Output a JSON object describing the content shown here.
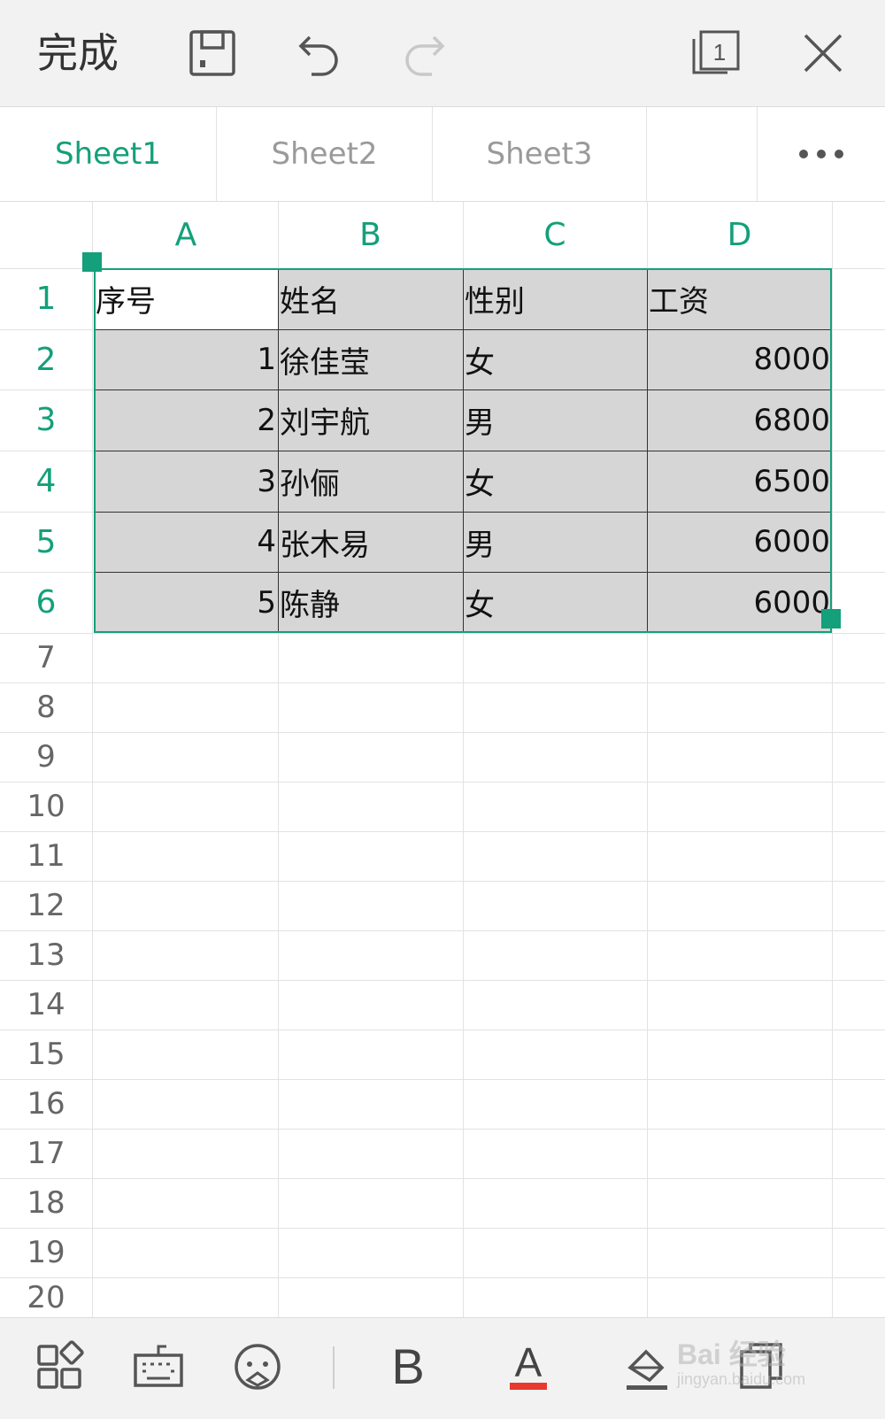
{
  "toolbar": {
    "done_label": "完成",
    "icons": [
      "save-icon",
      "undo-icon",
      "redo-icon",
      "window-count-icon",
      "close-icon"
    ],
    "window_count": "1"
  },
  "tabs": [
    {
      "label": "Sheet1",
      "active": true
    },
    {
      "label": "Sheet2",
      "active": false
    },
    {
      "label": "Sheet3",
      "active": false
    }
  ],
  "columns": [
    "A",
    "B",
    "C",
    "D"
  ],
  "rows": [
    "1",
    "2",
    "3",
    "4",
    "5",
    "6",
    "7",
    "8",
    "9",
    "10",
    "11",
    "12",
    "13",
    "14",
    "15",
    "16",
    "17",
    "18",
    "19",
    "20"
  ],
  "table": {
    "header": [
      "序号",
      "姓名",
      "性别",
      "工资"
    ],
    "data": [
      [
        "1",
        "徐佳莹",
        "女",
        "8000"
      ],
      [
        "2",
        "刘宇航",
        "男",
        "6800"
      ],
      [
        "3",
        "孙俪",
        "女",
        "6500"
      ],
      [
        "4",
        "张木易",
        "男",
        "6000"
      ],
      [
        "5",
        "陈静",
        "女",
        "6000"
      ]
    ]
  },
  "selection": {
    "range": "A1:D6",
    "color": "#13a07a"
  },
  "bottom_bar": {
    "icons": [
      "apps-icon",
      "keyboard-icon",
      "emoji-icon",
      "bold-icon",
      "font-color-icon",
      "fill-color-icon",
      "copy-icon"
    ],
    "bold_label": "B",
    "font_color_label": "A",
    "font_color": "#e8392f"
  },
  "colors": {
    "accent": "#13a07a",
    "selected_fill": "#d6d6d6"
  },
  "watermark": {
    "text": "Bai 经验",
    "sub": "jingyan.baidu.com"
  }
}
